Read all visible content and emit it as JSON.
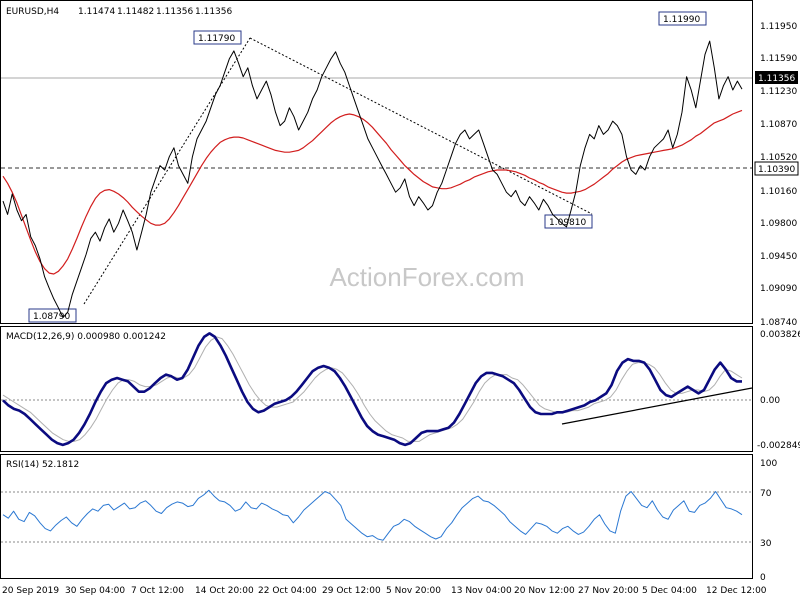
{
  "chart_data": [
    {
      "type": "line",
      "panel": "price",
      "title": "EURUSD,H4",
      "ohlc_header": [
        "1.11474",
        "1.11482",
        "1.11356",
        "1.11356"
      ],
      "ylim": [
        1.0874,
        1.1216
      ],
      "y_ticks": [
        "1.11950",
        "1.11590",
        "1.11230",
        "1.10870",
        "1.10520",
        "1.10160",
        "1.09800",
        "1.09450",
        "1.09090",
        "1.08740"
      ],
      "current_price_label": "1.11356",
      "support_label": "1.10390",
      "annotations": [
        "1.11790",
        "1.08790",
        "1.09810",
        "1.11990"
      ],
      "watermark": "ActionForex.com",
      "series": [
        {
          "values": [
            1.101,
            1.0995,
            1.1018,
            1.1,
            1.0988,
            1.0995,
            1.097,
            1.096,
            1.0945,
            1.0925,
            1.0912,
            1.09,
            1.089,
            1.0879,
            1.0885,
            1.0905,
            1.092,
            1.0935,
            1.095,
            1.0968,
            1.0975,
            1.0965,
            1.098,
            1.099,
            1.0975,
            1.0985,
            1.1,
            1.0988,
            1.0975,
            1.0955,
            1.0975,
            1.0995,
            1.102,
            1.1035,
            1.105,
            1.1045,
            1.106,
            1.107,
            1.105,
            1.104,
            1.103,
            1.106,
            1.108,
            1.109,
            1.11,
            1.1115,
            1.113,
            1.114,
            1.1155,
            1.117,
            1.1179,
            1.1165,
            1.115,
            1.116,
            1.114,
            1.1125,
            1.1135,
            1.1145,
            1.113,
            1.111,
            1.1095,
            1.11,
            1.1115,
            1.1105,
            1.109,
            1.11,
            1.111,
            1.1125,
            1.1135,
            1.115,
            1.116,
            1.117,
            1.1178,
            1.1165,
            1.1155,
            1.114,
            1.1125,
            1.111,
            1.1095,
            1.108,
            1.107,
            1.106,
            1.105,
            1.104,
            1.103,
            1.102,
            1.1025,
            1.1035,
            1.1015,
            1.1005,
            1.1015,
            1.1008,
            1.1,
            1.1005,
            1.102,
            1.103,
            1.1045,
            1.106,
            1.1075,
            1.1085,
            1.109,
            1.108,
            1.1085,
            1.109,
            1.1075,
            1.106,
            1.1045,
            1.104,
            1.103,
            1.102,
            1.1015,
            1.1022,
            1.101,
            1.1005,
            1.1015,
            1.1008,
            1.1,
            1.1012,
            1.1005,
            1.0995,
            1.099,
            1.0985,
            1.0981,
            1.1,
            1.102,
            1.105,
            1.107,
            1.1085,
            1.108,
            1.1095,
            1.1085,
            1.109,
            1.11,
            1.1095,
            1.1085,
            1.106,
            1.1045,
            1.104,
            1.105,
            1.1045,
            1.106,
            1.107,
            1.1075,
            1.108,
            1.109,
            1.107,
            1.1085,
            1.111,
            1.115,
            1.1135,
            1.1115,
            1.1145,
            1.1175,
            1.119,
            1.116,
            1.1125,
            1.114,
            1.115,
            1.1135,
            1.1145,
            1.1136
          ]
        },
        {
          "values": [
            1.1038,
            1.103,
            1.102,
            1.1008,
            1.0994,
            1.098,
            1.0966,
            1.0953,
            1.0942,
            1.0934,
            1.0929,
            1.0928,
            1.0931,
            1.0937,
            1.0945,
            1.0956,
            1.0968,
            1.0981,
            1.0993,
            1.1004,
            1.1013,
            1.1019,
            1.1022,
            1.1023,
            1.1021,
            1.1018,
            1.1014,
            1.1009,
            1.1003,
            1.0998,
            1.0993,
            1.0989,
            1.0985,
            1.0983,
            1.0983,
            1.0985,
            1.099,
            1.0997,
            1.1005,
            1.1014,
            1.1023,
            1.1032,
            1.1041,
            1.105,
            1.1058,
            1.1065,
            1.1071,
            1.1076,
            1.1079,
            1.1081,
            1.1082,
            1.1082,
            1.1081,
            1.1079,
            1.1077,
            1.1075,
            1.1073,
            1.1071,
            1.1069,
            1.1067,
            1.1066,
            1.1065,
            1.1065,
            1.1066,
            1.1067,
            1.107,
            1.1074,
            1.1078,
            1.1083,
            1.1088,
            1.1093,
            1.1098,
            1.1102,
            1.1105,
            1.1107,
            1.1108,
            1.1107,
            1.1105,
            1.1102,
            1.1098,
            1.1093,
            1.1087,
            1.1081,
            1.1075,
            1.1068,
            1.1062,
            1.1056,
            1.105,
            1.1045,
            1.104,
            1.1036,
            1.1032,
            1.1029,
            1.1026,
            1.1025,
            1.1024,
            1.1024,
            1.1025,
            1.1027,
            1.1029,
            1.1032,
            1.1034,
            1.1037,
            1.1039,
            1.1041,
            1.1043,
            1.1044,
            1.1045,
            1.1045,
            1.1045,
            1.1044,
            1.1043,
            1.1041,
            1.1039,
            1.1036,
            1.1034,
            1.1031,
            1.1029,
            1.1026,
            1.1024,
            1.1022,
            1.102,
            1.1019,
            1.1019,
            1.102,
            1.1021,
            1.1023,
            1.1026,
            1.1029,
            1.1033,
            1.1037,
            1.1041,
            1.1046,
            1.105,
            1.1054,
            1.1057,
            1.1059,
            1.1061,
            1.1062,
            1.1063,
            1.1064,
            1.1065,
            1.1066,
            1.1067,
            1.1068,
            1.1069,
            1.1071,
            1.1073,
            1.1076,
            1.1079,
            1.1083,
            1.1086,
            1.109,
            1.1094,
            1.1098,
            1.11,
            1.1102,
            1.1105,
            1.1108,
            1.111,
            1.1112
          ]
        }
      ]
    },
    {
      "type": "line",
      "panel": "macd",
      "title": "MACD(12,26,9) 0.000980 0.001242",
      "ylim": [
        -0.003,
        0.004
      ],
      "y_ticks": [
        "0.003826",
        "0.00",
        "-0.002849"
      ],
      "series": [
        {
          "values": [
            -0.0001,
            -0.0004,
            -0.0006,
            -0.0007,
            -0.0009,
            -0.0012,
            -0.0015,
            -0.0018,
            -0.0021,
            -0.0024,
            -0.0026,
            -0.0027,
            -0.0026,
            -0.0024,
            -0.002,
            -0.0015,
            -0.0009,
            -0.0002,
            0.0004,
            0.0009,
            0.0011,
            0.0012,
            0.0011,
            0.001,
            0.0007,
            0.0004,
            0.0004,
            0.0006,
            0.0009,
            0.0012,
            0.0014,
            0.0013,
            0.0011,
            0.0012,
            0.0017,
            0.0024,
            0.0031,
            0.0036,
            0.0038,
            0.0036,
            0.0031,
            0.0025,
            0.0018,
            0.0011,
            0.0004,
            -0.0002,
            -0.0006,
            -0.0008,
            -0.0007,
            -0.0005,
            -0.0003,
            -0.0002,
            -0.0001,
            0.0001,
            0.0004,
            0.0008,
            0.0012,
            0.0016,
            0.0018,
            0.0019,
            0.0018,
            0.0016,
            0.0012,
            0.0007,
            0.0001,
            -0.0005,
            -0.0011,
            -0.0016,
            -0.0019,
            -0.0021,
            -0.0022,
            -0.0023,
            -0.0024,
            -0.0026,
            -0.0027,
            -0.0026,
            -0.0023,
            -0.002,
            -0.0019,
            -0.0019,
            -0.0019,
            -0.0018,
            -0.0017,
            -0.0014,
            -0.0009,
            -0.0003,
            0.0003,
            0.0009,
            0.0013,
            0.0015,
            0.0015,
            0.0014,
            0.0013,
            0.0011,
            0.0009,
            0.0005,
            0.0,
            -0.0005,
            -0.0008,
            -0.0009,
            -0.0009,
            -0.0009,
            -0.0008,
            -0.0008,
            -0.0007,
            -0.0006,
            -0.0005,
            -0.0004,
            -0.0002,
            -0.0001,
            0.0001,
            0.0003,
            0.0008,
            0.0016,
            0.0021,
            0.0023,
            0.0022,
            0.0022,
            0.0021,
            0.0017,
            0.0011,
            0.0005,
            0.0002,
            0.0001,
            0.0003,
            0.0005,
            0.0007,
            0.0005,
            0.0003,
            0.0005,
            0.0011,
            0.0017,
            0.0021,
            0.0017,
            0.0012,
            0.001,
            0.001
          ]
        },
        {
          "values": [
            0.0002,
            0.0,
            -0.0002,
            -0.0004,
            -0.0006,
            -0.0008,
            -0.0011,
            -0.0014,
            -0.0017,
            -0.002,
            -0.0022,
            -0.0024,
            -0.0025,
            -0.0025,
            -0.0024,
            -0.0021,
            -0.0017,
            -0.0012,
            -0.0006,
            0.0,
            0.0005,
            0.0009,
            0.0011,
            0.0011,
            0.001,
            0.0008,
            0.0007,
            0.0007,
            0.0008,
            0.001,
            0.0012,
            0.0013,
            0.0012,
            0.0012,
            0.0014,
            0.0018,
            0.0024,
            0.003,
            0.0034,
            0.0036,
            0.0035,
            0.0031,
            0.0026,
            0.002,
            0.0014,
            0.0008,
            0.0003,
            -0.0001,
            -0.0004,
            -0.0005,
            -0.0005,
            -0.0004,
            -0.0003,
            -0.0002,
            0.0001,
            0.0004,
            0.0008,
            0.0012,
            0.0015,
            0.0017,
            0.0018,
            0.0017,
            0.0015,
            0.0011,
            0.0007,
            0.0002,
            -0.0004,
            -0.0009,
            -0.0013,
            -0.0016,
            -0.0019,
            -0.0021,
            -0.0022,
            -0.0023,
            -0.0025,
            -0.0025,
            -0.0025,
            -0.0023,
            -0.0021,
            -0.002,
            -0.0019,
            -0.0018,
            -0.0017,
            -0.0015,
            -0.0012,
            -0.0007,
            -0.0002,
            0.0004,
            0.0009,
            0.0012,
            0.0014,
            0.0014,
            0.0014,
            0.0012,
            0.0011,
            0.0008,
            0.0004,
            0.0,
            -0.0004,
            -0.0006,
            -0.0007,
            -0.0008,
            -0.0008,
            -0.0008,
            -0.0007,
            -0.0007,
            -0.0006,
            -0.0005,
            -0.0003,
            -0.0002,
            -0.0001,
            0.0001,
            0.0005,
            0.0011,
            0.0016,
            0.002,
            0.0021,
            0.0021,
            0.002,
            0.0018,
            0.0014,
            0.0009,
            0.0005,
            0.0003,
            0.0003,
            0.0004,
            0.0005,
            0.0005,
            0.0004,
            0.0005,
            0.0008,
            0.0013,
            0.0017,
            0.0016,
            0.0014,
            0.0012
          ]
        }
      ]
    },
    {
      "type": "line",
      "panel": "rsi",
      "title": "RSI(14) 52.1812",
      "ylim": [
        0,
        100
      ],
      "y_ticks": [
        "100",
        "70",
        "30",
        "0"
      ],
      "series": [
        {
          "values": [
            52,
            49,
            55,
            48,
            46,
            54,
            51,
            45,
            40,
            38,
            43,
            47,
            50,
            45,
            42,
            48,
            53,
            57,
            55,
            60,
            61,
            56,
            59,
            62,
            57,
            58,
            62,
            64,
            60,
            55,
            53,
            58,
            61,
            63,
            62,
            59,
            60,
            66,
            69,
            73,
            68,
            64,
            63,
            60,
            55,
            57,
            63,
            58,
            57,
            62,
            60,
            57,
            55,
            52,
            51,
            45,
            50,
            56,
            60,
            64,
            68,
            72,
            70,
            65,
            60,
            48,
            44,
            40,
            36,
            33,
            34,
            31,
            30,
            36,
            42,
            44,
            48,
            46,
            42,
            39,
            36,
            33,
            31,
            33,
            40,
            45,
            52,
            58,
            62,
            66,
            68,
            64,
            63,
            60,
            56,
            52,
            46,
            42,
            38,
            35,
            40,
            45,
            44,
            42,
            38,
            36,
            40,
            42,
            38,
            35,
            37,
            42,
            48,
            52,
            44,
            38,
            36,
            55,
            68,
            72,
            66,
            60,
            58,
            64,
            56,
            50,
            48,
            56,
            60,
            64,
            55,
            54,
            60,
            62,
            66,
            72,
            65,
            58,
            57,
            55,
            52
          ]
        }
      ]
    }
  ],
  "x_ticks": [
    "20 Sep 2019",
    "30 Sep 04:00",
    "7 Oct 12:00",
    "14 Oct 20:00",
    "22 Oct 04:00",
    "29 Oct 12:00",
    "5 Nov 20:00",
    "13 Nov 04:00",
    "20 Nov 12:00",
    "27 Nov 20:00",
    "5 Dec 04:00",
    "12 Dec 12:00"
  ],
  "colors": {
    "price": "#000000",
    "sma": "#d21e1e",
    "trendline": "#000000",
    "macd": "#0b0b80",
    "signal": "#b0b0b0",
    "rsi": "#2b78d2",
    "grid": "#9a9a9a",
    "current_box": "#000000",
    "current_text": "#ffffff",
    "label_border": "#2a3a8a"
  }
}
